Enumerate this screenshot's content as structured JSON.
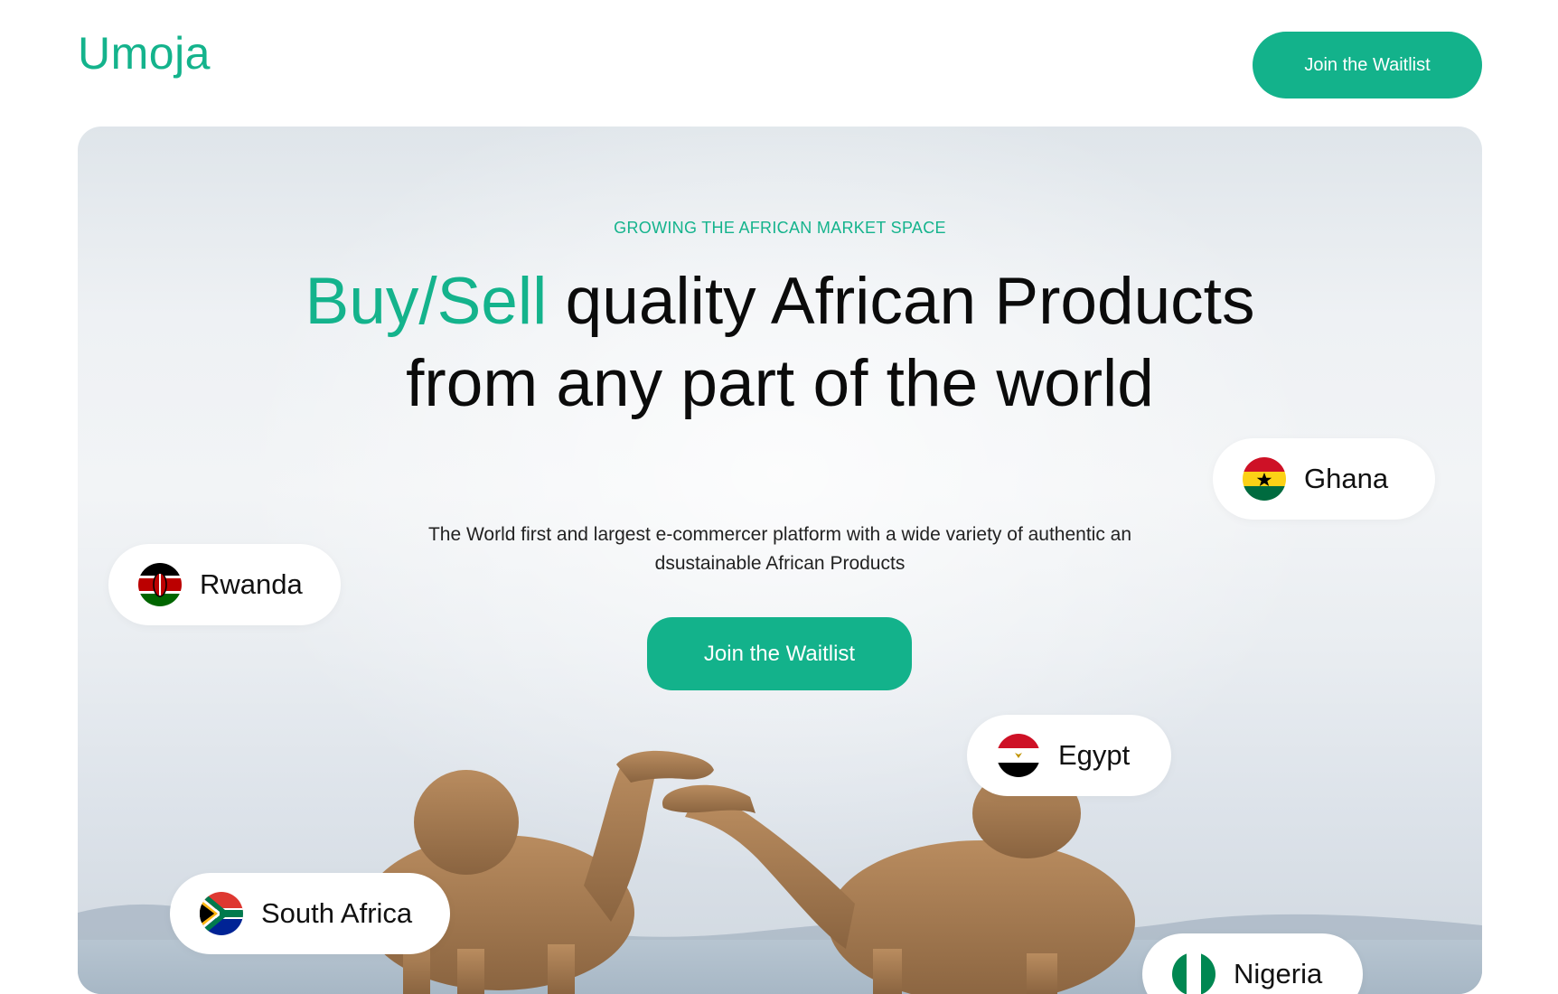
{
  "header": {
    "logo": "Umoja",
    "waitlist_label": "Join the Waitlist"
  },
  "hero": {
    "eyebrow": "GROWING THE AFRICAN MARKET SPACE",
    "headline_accent": "Buy/Sell",
    "headline_rest": " quality African Products from any part of the world",
    "subtitle": "The  World first and largest e-commercer platform with a wide variety of authentic an dsustainable African Products",
    "cta_label": "Join the Waitlist"
  },
  "countries": [
    {
      "label": "Ghana",
      "icon": "ghana-flag-icon"
    },
    {
      "label": "Rwanda",
      "icon": "kenya-flag-icon"
    },
    {
      "label": "Egypt",
      "icon": "egypt-flag-icon"
    },
    {
      "label": "South Africa",
      "icon": "south-africa-flag-icon"
    },
    {
      "label": "Nigeria",
      "icon": "nigeria-flag-icon"
    }
  ],
  "colors": {
    "accent": "#14b38c",
    "button": "#13b28b",
    "text": "#0b0b0b"
  }
}
